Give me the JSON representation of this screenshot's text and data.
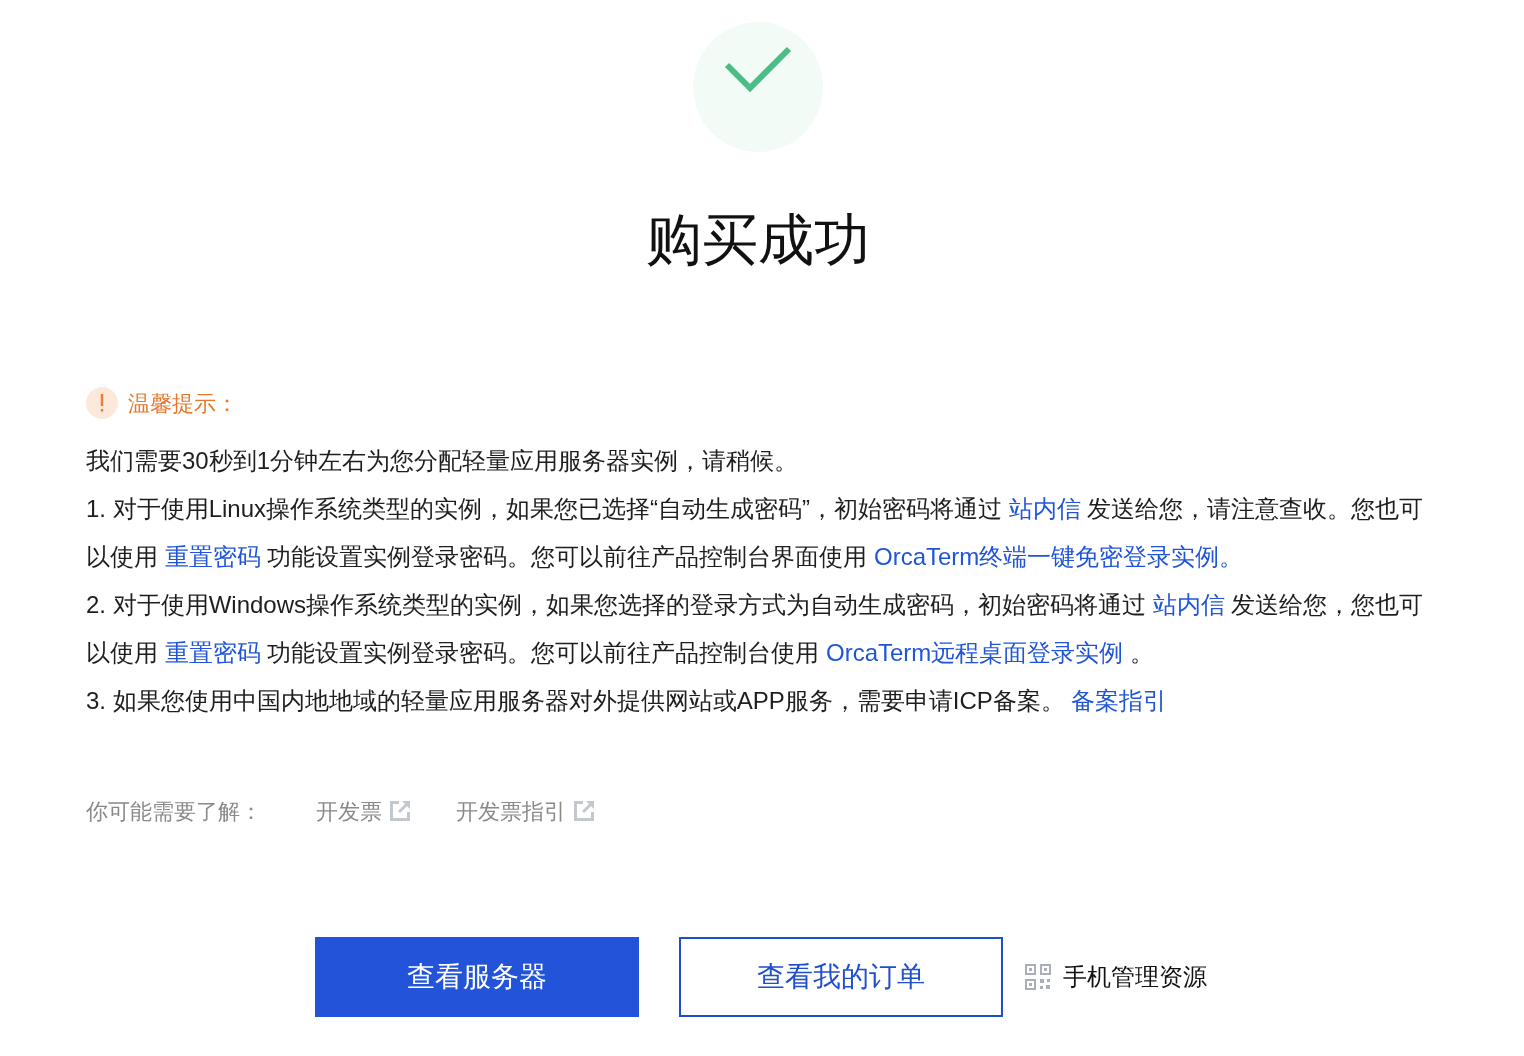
{
  "result": {
    "title": "购买成功"
  },
  "notice": {
    "heading": "温馨提示：",
    "paragraphs": [
      {
        "segments": [
          {
            "kind": "text",
            "text": "我们需要30秒到1分钟左右为您分配轻量应用服务器实例，请稍候。"
          }
        ]
      },
      {
        "segments": [
          {
            "kind": "text",
            "text": "1. 对于使用Linux操作系统类型的实例，如果您已选择“自动生成密码”，初始密码将通过 "
          },
          {
            "kind": "link",
            "text": "站内信"
          },
          {
            "kind": "text",
            "text": " 发送给您，请注意查收。您也可以使用 "
          },
          {
            "kind": "link",
            "text": "重置密码"
          },
          {
            "kind": "text",
            "text": " 功能设置实例登录密码。您可以前往产品控制台界面使用 "
          },
          {
            "kind": "link",
            "text": "OrcaTerm终端一键免密登录实例。"
          }
        ]
      },
      {
        "segments": [
          {
            "kind": "text",
            "text": "2. 对于使用Windows操作系统类型的实例，如果您选择的登录方式为自动生成密码，初始密码将通过 "
          },
          {
            "kind": "link",
            "text": "站内信"
          },
          {
            "kind": "text",
            "text": " 发送给您，您也可以使用 "
          },
          {
            "kind": "link",
            "text": "重置密码"
          },
          {
            "kind": "text",
            "text": " 功能设置实例登录密码。您可以前往产品控制台使用 "
          },
          {
            "kind": "link",
            "text": "OrcaTerm远程桌面登录实例"
          },
          {
            "kind": "text",
            "text": " 。"
          }
        ]
      },
      {
        "segments": [
          {
            "kind": "text",
            "text": "3. 如果您使用中国内地地域的轻量应用服务器对外提供网站或APP服务，需要申请ICP备案。 "
          },
          {
            "kind": "link",
            "text": "备案指引"
          }
        ]
      }
    ]
  },
  "related": {
    "label": "你可能需要了解：",
    "links": [
      {
        "label": "开发票"
      },
      {
        "label": "开发票指引"
      }
    ]
  },
  "actions": [
    {
      "kind": "primary",
      "label": "查看服务器"
    },
    {
      "kind": "outline",
      "label": "查看我的订单"
    },
    {
      "kind": "qr",
      "label": "手机管理资源"
    }
  ]
}
